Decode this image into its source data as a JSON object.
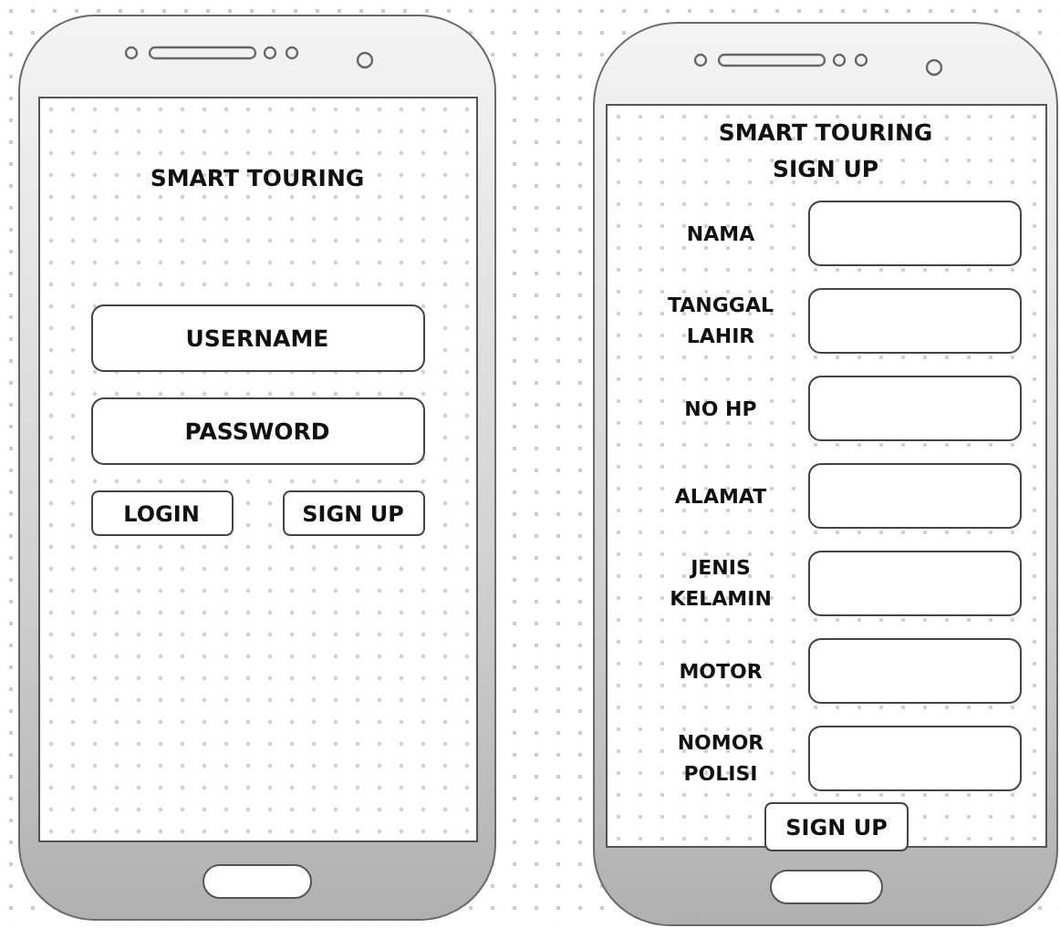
{
  "login_screen": {
    "title": "SMART TOURING",
    "fields": [
      {
        "placeholder": "USERNAME"
      },
      {
        "placeholder": "PASSWORD"
      }
    ],
    "buttons": [
      "LOGIN",
      "SIGN UP"
    ]
  },
  "signup_screen": {
    "title": "SMART TOURING",
    "subtitle": "SIGN UP",
    "fields": [
      {
        "label": "NAMA"
      },
      {
        "label": "TANGGAL LAHIR"
      },
      {
        "label": "NO HP"
      },
      {
        "label": "ALAMAT"
      },
      {
        "label": "JENIS KELAMIN"
      },
      {
        "label": "MOTOR"
      },
      {
        "label": "NOMOR POLISI"
      }
    ],
    "button": "SIGN UP"
  }
}
